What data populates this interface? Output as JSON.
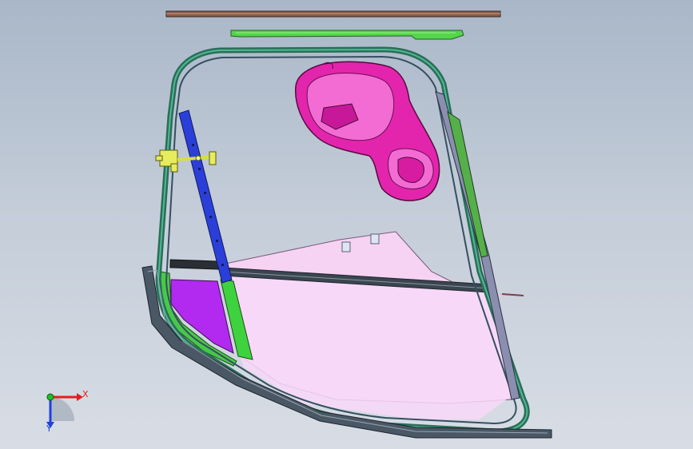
{
  "viewport": {
    "background_top": "#a9b7c8",
    "background_bottom": "#d8dde5"
  },
  "colors": {
    "frame_tube": "#2f8a6a",
    "frame_dark": "#3c4a55",
    "glass_panel": "#f3cdf1",
    "lock_housing": "#e020a8",
    "lock_housing_light": "#f26ad1",
    "vertical_rail": "#2a3fd6",
    "hinge_bracket": "#e4ea5a",
    "purple_panel": "#b62cf0",
    "green_strip": "#3fcf3f",
    "top_seal": "#7a4a3a",
    "axis_x": "#e02020",
    "axis_y": "#2040e0",
    "axis_origin": "#20c020"
  },
  "triad": {
    "x_label": "X",
    "y_label": "Y"
  }
}
